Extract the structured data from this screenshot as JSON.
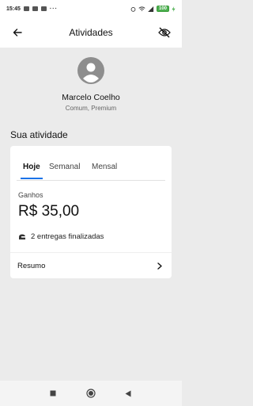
{
  "status_bar": {
    "time": "15:45",
    "battery": "100",
    "dots": "···"
  },
  "app_bar": {
    "title": "Atividades",
    "back_icon": "arrow-left-icon",
    "visibility_icon": "eye-off-icon"
  },
  "profile": {
    "name": "Marcelo Coelho",
    "type": "Comum, Premium",
    "avatar_icon": "account-circle-icon"
  },
  "activity": {
    "section_title": "Sua atividade",
    "tabs": [
      {
        "label": "Hoje",
        "active": true
      },
      {
        "label": "Semanal",
        "active": false
      },
      {
        "label": "Mensal",
        "active": false
      }
    ],
    "earnings_label": "Ganhos",
    "earnings_value": "R$ 35,00",
    "deliveries_text": "2 entregas finalizadas",
    "summary_label": "Resumo"
  },
  "colors": {
    "accent": "#1a73e8",
    "background": "#ebebeb",
    "card": "#ffffff",
    "battery": "#4caf50"
  }
}
